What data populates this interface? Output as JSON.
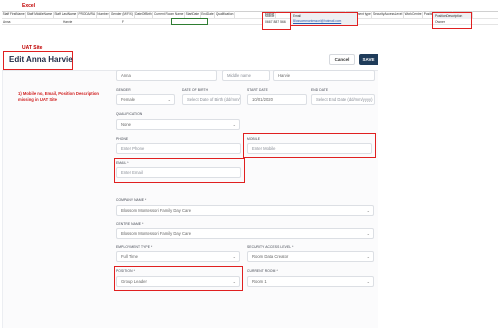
{
  "excel": {
    "label": "Excel",
    "headers": [
      "Staff FirstName",
      "Staff MiddleName",
      "Staff LastName",
      "PRODA/RA",
      "Number",
      "Gender (M/F/X)",
      "DateOfBirth",
      "Current Room Name",
      "StartDate",
      "EndDate",
      "Qualification",
      "Mobile",
      "Email",
      "Employment type",
      "SecurityAccessLevel",
      "WorkCentre",
      "PositionDescription",
      "PoliceCheck"
    ],
    "row": {
      "first": "Anna",
      "last": "Harvie",
      "gender": "F",
      "mobile": "0667 887 566",
      "email": "Blossommontessori@hotmail.com",
      "position": "Owner"
    }
  },
  "uat": {
    "label": "UAT Site",
    "title": "Edit Anna Harvie",
    "cancel": "Cancel",
    "save": "SAVE",
    "note": "1) Mobile no, Email, Position Description missing in UAT Site",
    "first_name": "Anna",
    "middle_name_placeholder": "Middle name",
    "last_name": "Harvie",
    "gender_label": "GENDER",
    "gender": "Female",
    "dob_label": "DATE OF BIRTH",
    "dob_placeholder": "Select Date of Birth (dd/mm/yyyy)",
    "start_label": "START DATE",
    "start_date": "10/01/2020",
    "end_label": "END DATE",
    "end_placeholder": "Select End Date (dd/mm/yyyy)",
    "qualification_label": "QUALIFICATION",
    "qualification": "None",
    "phone_label": "PHONE",
    "phone_placeholder": "Enter Phone",
    "mobile_label": "MOBILE",
    "mobile_placeholder": "Enter Mobile",
    "email_label": "EMAIL *",
    "email_placeholder": "Enter Email",
    "company_label": "COMPANY NAME *",
    "company": "Blossom Montessori Family Day Care",
    "centre_label": "CENTRE NAME *",
    "centre": "Blossom Montessori Family Day Care",
    "employment_label": "EMPLOYMENT TYPE *",
    "employment": "Full Time",
    "security_label": "SECURITY ACCESS LEVEL *",
    "security": "Room Data Creator",
    "position_label": "POSITION *",
    "position": "Group Leader",
    "room_label": "CURRENT ROOM *",
    "room": "Room 1"
  },
  "colors": {
    "annotation_red": "#e02020",
    "save_button": "#1f3c5a",
    "excel_select": "#2e7d32"
  }
}
